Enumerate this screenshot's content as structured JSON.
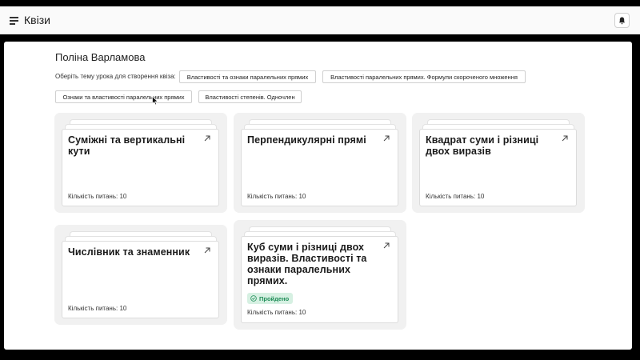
{
  "header": {
    "title": "Квізи"
  },
  "user": {
    "name": "Поліна Варламова"
  },
  "topic_prompt": "Оберіть тему урока для створення квіза:",
  "topics": [
    "Властивості та ознаки паралельних прямих",
    "Властивості паралельних прямих. Формули скороченого множення",
    "Ознаки та властивості паралельних прямих",
    "Властивості степенів. Одночлен"
  ],
  "quizzes": [
    {
      "title": "Суміжні та вертикальні кути",
      "count_label": "Кількість питань: 10"
    },
    {
      "title": "Перпендикулярні прямі",
      "count_label": "Кількість питань: 10"
    },
    {
      "title": "Квадрат суми і різниці двох виразів",
      "count_label": "Кількість питань: 10"
    },
    {
      "title": "Числівник та знаменник",
      "count_label": "Кількість питань: 10"
    },
    {
      "title": "Куб суми і різниці двох виразів. Властивості та ознаки паралельних прямих.",
      "count_label": "Кількість питань: 10",
      "status": "Пройдено"
    }
  ],
  "icons": {
    "menu": "menu-icon",
    "notifications": "bell-icon",
    "open_quiz": "arrow-up-right-icon",
    "passed": "check-circle-icon"
  },
  "colors": {
    "passed_bg": "#d6f0e2",
    "passed_text": "#1e8c57",
    "card_bg": "#f1f1f1"
  }
}
